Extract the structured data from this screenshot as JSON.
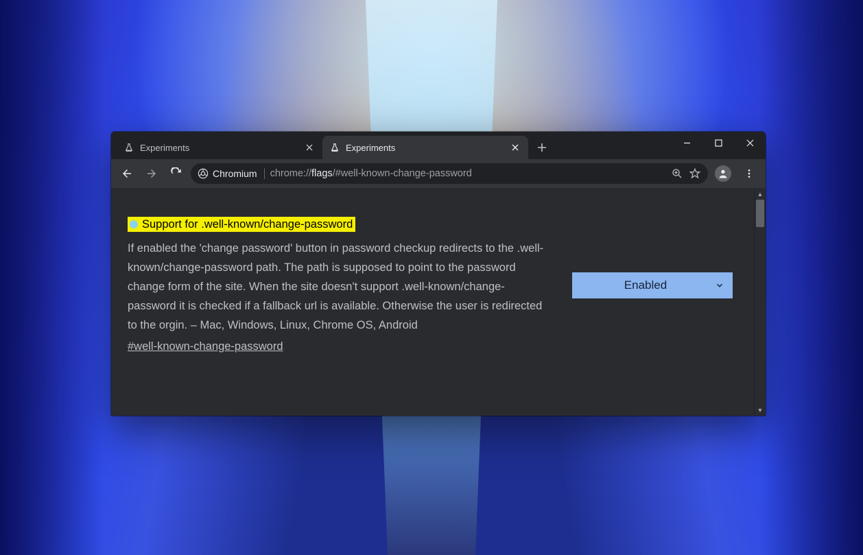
{
  "tabs": [
    {
      "title": "Experiments",
      "active": false
    },
    {
      "title": "Experiments",
      "active": true
    }
  ],
  "omnibox": {
    "chip_label": "Chromium",
    "url_prefix": "chrome://",
    "url_bold": "flags",
    "url_suffix": "/#well-known-change-password"
  },
  "flag": {
    "title": "Support for .well-known/change-password",
    "description": "If enabled the 'change password' button in password checkup redirects to the .well-known/change-password path. The path is supposed to point to the password change form of the site. When the site doesn't support .well-known/change-password it is checked if a fallback url is available. Otherwise the user is redirected to the orgin. – Mac, Windows, Linux, Chrome OS, Android",
    "anchor": "#well-known-change-password",
    "select_value": "Enabled"
  }
}
